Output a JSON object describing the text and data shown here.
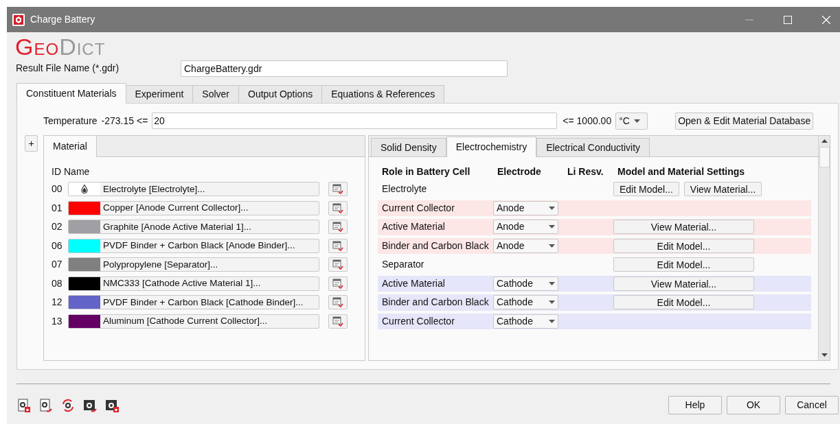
{
  "window": {
    "title": "Charge Battery"
  },
  "logo": {
    "first": "Geo",
    "second": "Dict"
  },
  "result_file": {
    "label": "Result File Name (*.gdr)",
    "value": "ChargeBattery.gdr"
  },
  "tabs": [
    {
      "label": "Constituent Materials",
      "selected": true
    },
    {
      "label": "Experiment",
      "selected": false
    },
    {
      "label": "Solver",
      "selected": false
    },
    {
      "label": "Output Options",
      "selected": false
    },
    {
      "label": "Equations & References",
      "selected": false
    }
  ],
  "temperature": {
    "label": "Temperature",
    "min": "-273.15 <=",
    "value": "20",
    "max": "<= 1000.00",
    "unit": "°C",
    "database_button": "Open & Edit Material Database"
  },
  "add_button": "+",
  "material_panel": {
    "tabs": [
      {
        "label": "Material",
        "selected": true
      }
    ],
    "columns": [
      "ID",
      "Name"
    ],
    "materials": [
      {
        "id": "00",
        "name": "Electrolyte [Electrolyte]...",
        "kind": "electrolyte"
      },
      {
        "id": "01",
        "name": "Copper [Anode Current Collector]...",
        "kind": "solid",
        "color": "#ff0000"
      },
      {
        "id": "02",
        "name": "Graphite [Anode Active Material 1]...",
        "kind": "solid",
        "color": "#a0a0a4"
      },
      {
        "id": "06",
        "name": "PVDF Binder + Carbon Black [Anode Binder]...",
        "kind": "solid",
        "color": "#00ffff"
      },
      {
        "id": "07",
        "name": "Polypropylene [Separator]...",
        "kind": "solid",
        "color": "#808080"
      },
      {
        "id": "08",
        "name": "NMC333 [Cathode Active Material 1]...",
        "kind": "solid",
        "color": "#000000"
      },
      {
        "id": "12",
        "name": "PVDF Binder + Carbon Black [Cathode Binder]...",
        "kind": "solid",
        "color": "#6464c8"
      },
      {
        "id": "13",
        "name": "Aluminum [Cathode Current Collector]...",
        "kind": "solid",
        "color": "#640064"
      }
    ]
  },
  "property_panel": {
    "tabs": [
      {
        "label": "Solid Density",
        "selected": false
      },
      {
        "label": "Electrochemistry",
        "selected": true
      },
      {
        "label": "Electrical Conductivity",
        "selected": false
      }
    ],
    "columns": [
      "Role in Battery Cell",
      "Electrode",
      "Li Resv.",
      "Model and Material Settings"
    ],
    "rows": [
      {
        "role": "Electrolyte",
        "buttons": [
          "Edit Model...",
          "View Material..."
        ]
      },
      {
        "role": "Current Collector",
        "electrode": "Anode",
        "color": "#fde6e6"
      },
      {
        "role": "Active Material",
        "electrode": "Anode",
        "color": "#fde6e6",
        "buttons": [
          "View Material..."
        ]
      },
      {
        "role": "Binder and Carbon Black",
        "electrode": "Anode",
        "color": "#fde6e6",
        "buttons": [
          "Edit Model..."
        ]
      },
      {
        "role": "Separator",
        "buttons": [
          "Edit Model..."
        ]
      },
      {
        "role": "Active Material",
        "electrode": "Cathode",
        "color": "#e6e6fa",
        "buttons": [
          "View Material..."
        ]
      },
      {
        "role": "Binder and Carbon Black",
        "electrode": "Cathode",
        "color": "#e6e6fa",
        "buttons": [
          "Edit Model..."
        ]
      },
      {
        "role": "Current Collector",
        "electrode": "Cathode",
        "color": "#e6e6fa"
      }
    ]
  },
  "footer_buttons": [
    "Help",
    "OK",
    "Cancel"
  ]
}
